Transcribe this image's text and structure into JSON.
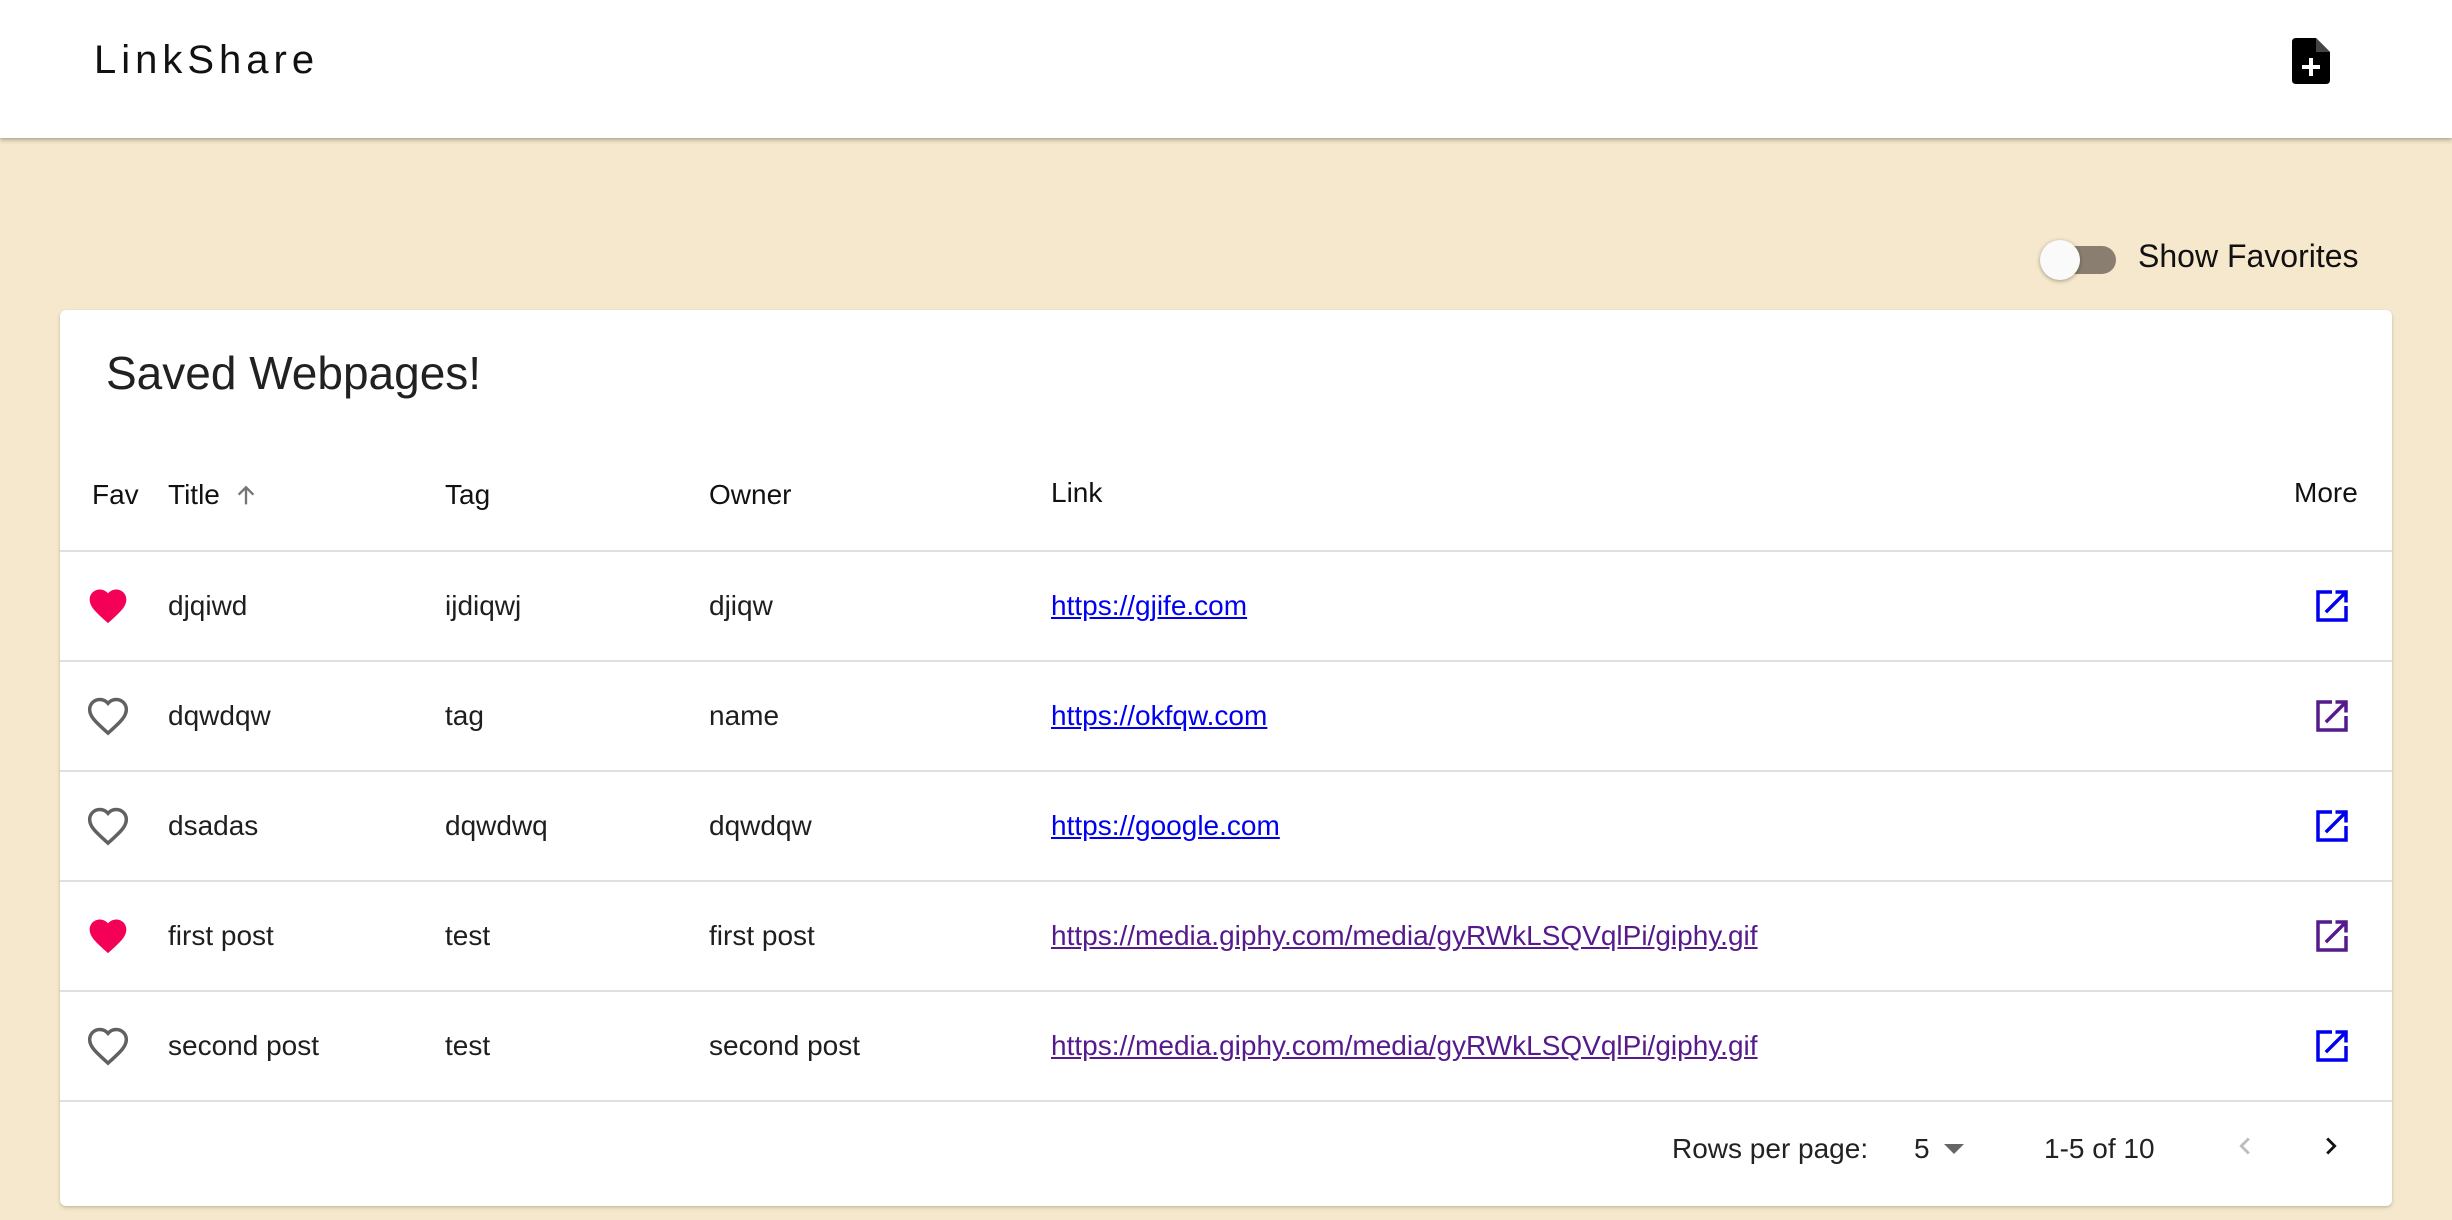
{
  "app": {
    "title": "LinkShare"
  },
  "toolbar": {
    "add_icon": "note-add-icon"
  },
  "filter": {
    "show_favorites_label": "Show Favorites",
    "show_favorites_on": false
  },
  "card": {
    "title": "Saved Webpages!"
  },
  "table": {
    "headers": {
      "fav": "Fav",
      "title": "Title",
      "tag": "Tag",
      "owner": "Owner",
      "link": "Link",
      "more": "More"
    },
    "sort": {
      "column": "Title",
      "direction": "ascending"
    },
    "rows": [
      {
        "fav": true,
        "title": "djqiwd",
        "tag": "ijdiqwj",
        "owner": "djiqw",
        "link": "https://gjife.com",
        "visited": false
      },
      {
        "fav": false,
        "title": "dqwdqw",
        "tag": "tag",
        "owner": "name",
        "link": "https://okfqw.com",
        "visited": false
      },
      {
        "fav": false,
        "title": "dsadas",
        "tag": "dqwdwq",
        "owner": "dqwdqw",
        "link": "https://google.com",
        "visited": false
      },
      {
        "fav": true,
        "title": "first post",
        "tag": "test",
        "owner": "first post",
        "link": "https://media.giphy.com/media/gyRWkLSQVqlPi/giphy.gif",
        "visited": true
      },
      {
        "fav": false,
        "title": "second post",
        "tag": "test",
        "owner": "second post",
        "link": "https://media.giphy.com/media/gyRWkLSQVqlPi/giphy.gif",
        "visited": true
      }
    ]
  },
  "pagination": {
    "rows_per_page_label": "Rows per page:",
    "rows_per_page_value": "5",
    "range_label": "1-5 of 10"
  },
  "colors": {
    "background": "#f5e8cc",
    "fav_active": "#f50057",
    "link": "#0000ee",
    "link_visited": "#551a8b",
    "toggle_track": "#8a7e70"
  }
}
